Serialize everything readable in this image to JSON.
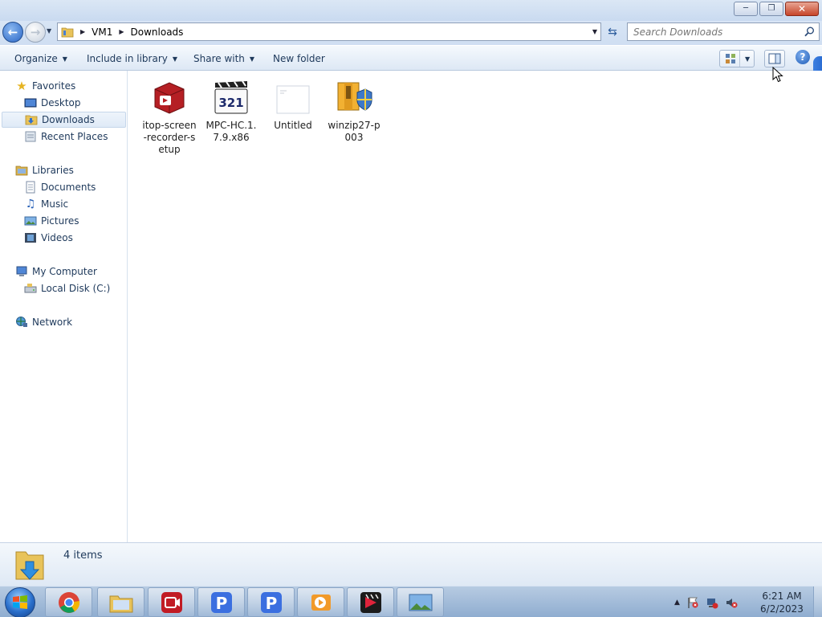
{
  "window": {
    "caption_buttons": {
      "minimize": "minimize-icon",
      "maximize": "restore-icon",
      "close": "close-icon"
    }
  },
  "address": {
    "breadcrumb": [
      "VM1",
      "Downloads"
    ],
    "search_placeholder": "Search Downloads"
  },
  "toolbar": {
    "organize": "Organize",
    "include_in_library": "Include in library",
    "share_with": "Share with",
    "new_folder": "New folder"
  },
  "nav": {
    "favorites": "Favorites",
    "desktop": "Desktop",
    "downloads": "Downloads",
    "recent_places": "Recent Places",
    "libraries": "Libraries",
    "documents": "Documents",
    "music": "Music",
    "pictures": "Pictures",
    "videos": "Videos",
    "my_computer": "My Computer",
    "local_disk": "Local Disk (C:)",
    "network": "Network",
    "selected": "Downloads"
  },
  "files": [
    {
      "name": "itop-screen-recorder-setup",
      "icon": "installer-box-icon"
    },
    {
      "name": "MPC-HC.1.7.9.x86",
      "icon": "media-player-clapper-icon"
    },
    {
      "name": "Untitled",
      "icon": "blank-document-icon"
    },
    {
      "name": "winzip27-p003",
      "icon": "winzip-installer-icon"
    }
  ],
  "details": {
    "item_count": "4 items"
  },
  "taskbar": {
    "pinned": [
      "chrome-icon",
      "file-explorer-icon",
      "screen-recorder-icon",
      "p-app-icon",
      "p-app-icon",
      "video-player-icon",
      "video-editor-icon",
      "photo-viewer-icon"
    ],
    "clock_time": "6:21 AM",
    "clock_date": "6/2/2023"
  }
}
